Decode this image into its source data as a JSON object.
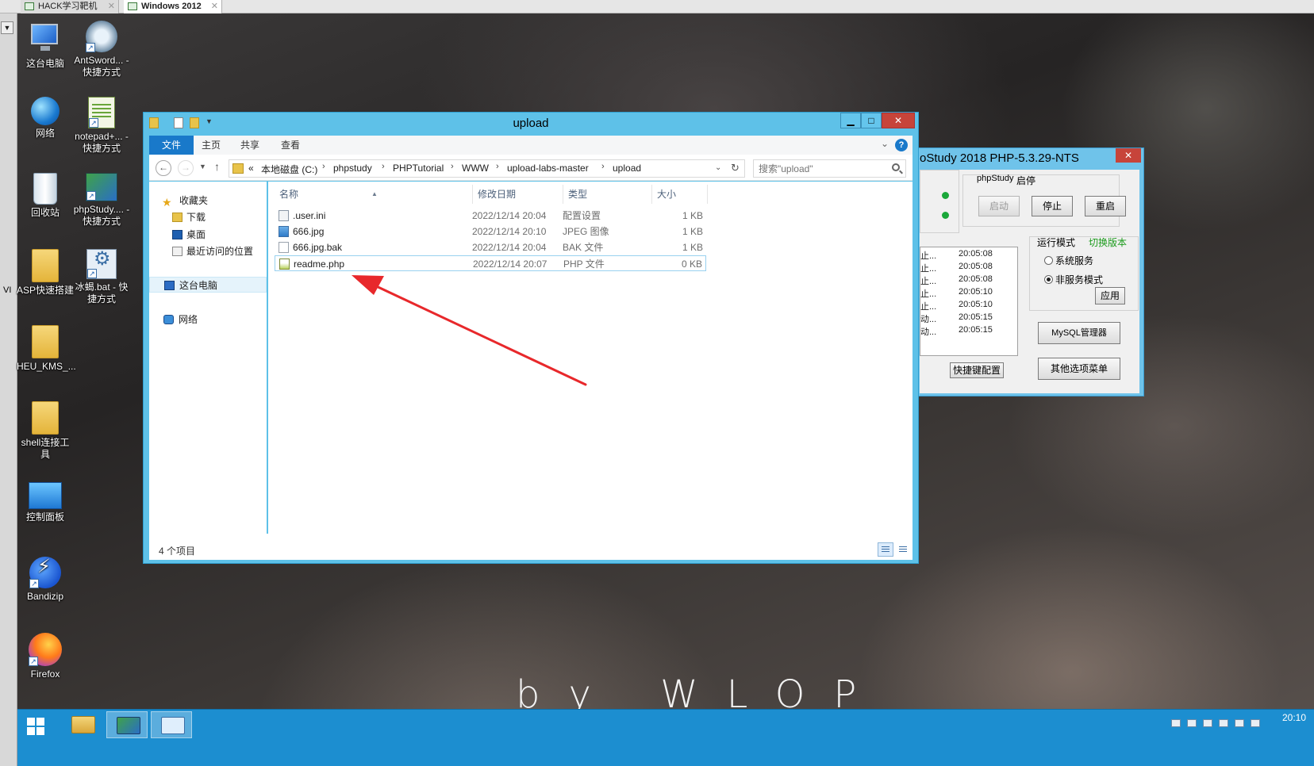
{
  "vm_tabs": [
    {
      "label": "HACK学习靶机",
      "active": false
    },
    {
      "label": "Windows 2012",
      "active": true
    }
  ],
  "vm_left_text": "VI",
  "desktop_icons": [
    {
      "label": "这台电脑",
      "icon": "this-pc-icon"
    },
    {
      "label": "AntSword... - 快捷方式",
      "icon": "antsword-icon"
    },
    {
      "label": "网络",
      "icon": "network-icon"
    },
    {
      "label": "notepad+... - 快捷方式",
      "icon": "notepad-plus-icon"
    },
    {
      "label": "回收站",
      "icon": "recycle-bin-icon"
    },
    {
      "label": "phpStudy.... - 快捷方式",
      "icon": "phpstudy-icon"
    },
    {
      "label": "ASP快速搭建",
      "icon": "folder-icon"
    },
    {
      "label": "冰蝎.bat - 快捷方式",
      "icon": "bat-file-icon"
    },
    {
      "label": "HEU_KMS_...",
      "icon": "folder-icon"
    },
    {
      "label": "shell连接工具",
      "icon": "folder-icon"
    },
    {
      "label": "控制面板",
      "icon": "control-panel-icon"
    },
    {
      "label": "Bandizip",
      "icon": "bandizip-icon"
    },
    {
      "label": "Firefox",
      "icon": "firefox-icon"
    }
  ],
  "explorer": {
    "title": "upload",
    "ribbon_tabs": [
      "文件",
      "主页",
      "共享",
      "查看"
    ],
    "help_label": "?",
    "breadcrumb": [
      "«",
      "本地磁盘 (C:)",
      "phpstudy",
      "PHPTutorial",
      "WWW",
      "upload-labs-master",
      "upload"
    ],
    "search_placeholder": "搜索\"upload\"",
    "nav": {
      "favorites": "收藏夹",
      "downloads": "下载",
      "desktop": "桌面",
      "recent": "最近访问的位置",
      "this_pc": "这台电脑",
      "network": "网络"
    },
    "columns": [
      "名称",
      "修改日期",
      "类型",
      "大小"
    ],
    "files": [
      {
        "name": ".user.ini",
        "date": "2022/12/14 20:04",
        "type": "配置设置",
        "size": "1 KB",
        "icon": "ini-file-icon"
      },
      {
        "name": "666.jpg",
        "date": "2022/12/14 20:10",
        "type": "JPEG 图像",
        "size": "1 KB",
        "icon": "jpeg-file-icon"
      },
      {
        "name": "666.jpg.bak",
        "date": "2022/12/14 20:04",
        "type": "BAK 文件",
        "size": "1 KB",
        "icon": "bak-file-icon"
      },
      {
        "name": "readme.php",
        "date": "2022/12/14 20:07",
        "type": "PHP 文件",
        "size": "0 KB",
        "icon": "php-file-icon",
        "selected": true
      }
    ],
    "status": "4 个项目",
    "window_buttons": {
      "minimize": "▁",
      "maximize": "□",
      "close": "✕"
    }
  },
  "phpstudy": {
    "title": "oStudy 2018  PHP-5.3.29-NTS",
    "close": "✕",
    "group_title_a": "phpStudy",
    "group_title_b": "启停",
    "buttons": {
      "start": "启动",
      "stop": "停止",
      "restart": "重启",
      "apply": "应用",
      "mysql": "MySQL管理器",
      "shortcut": "快捷键配置",
      "other": "其他选项菜单"
    },
    "run_mode_label": "运行模式",
    "switch_version": "切换版本",
    "modes": [
      {
        "label": "系统服务",
        "checked": false
      },
      {
        "label": "非服务模式",
        "checked": true
      }
    ],
    "log": [
      {
        "msg": "止...",
        "time": "20:05:08"
      },
      {
        "msg": "止...",
        "time": "20:05:08"
      },
      {
        "msg": "止...",
        "time": "20:05:08"
      },
      {
        "msg": "止...",
        "time": "20:05:10"
      },
      {
        "msg": "止...",
        "time": "20:05:10"
      },
      {
        "msg": "动...",
        "time": "20:05:15"
      },
      {
        "msg": "动...",
        "time": "20:05:15"
      }
    ],
    "colors": {
      "running": "#1aa83a",
      "switch_version": "#1a9a1a"
    }
  },
  "watermark": "by WLOP",
  "taskbar": {
    "clock": "20:10"
  },
  "colors": {
    "window_frame": "#5ec1e8",
    "ribbon_active": "#1979ca",
    "annotation_arrow": "#e8282b",
    "taskbar": "#1c8ed0"
  }
}
